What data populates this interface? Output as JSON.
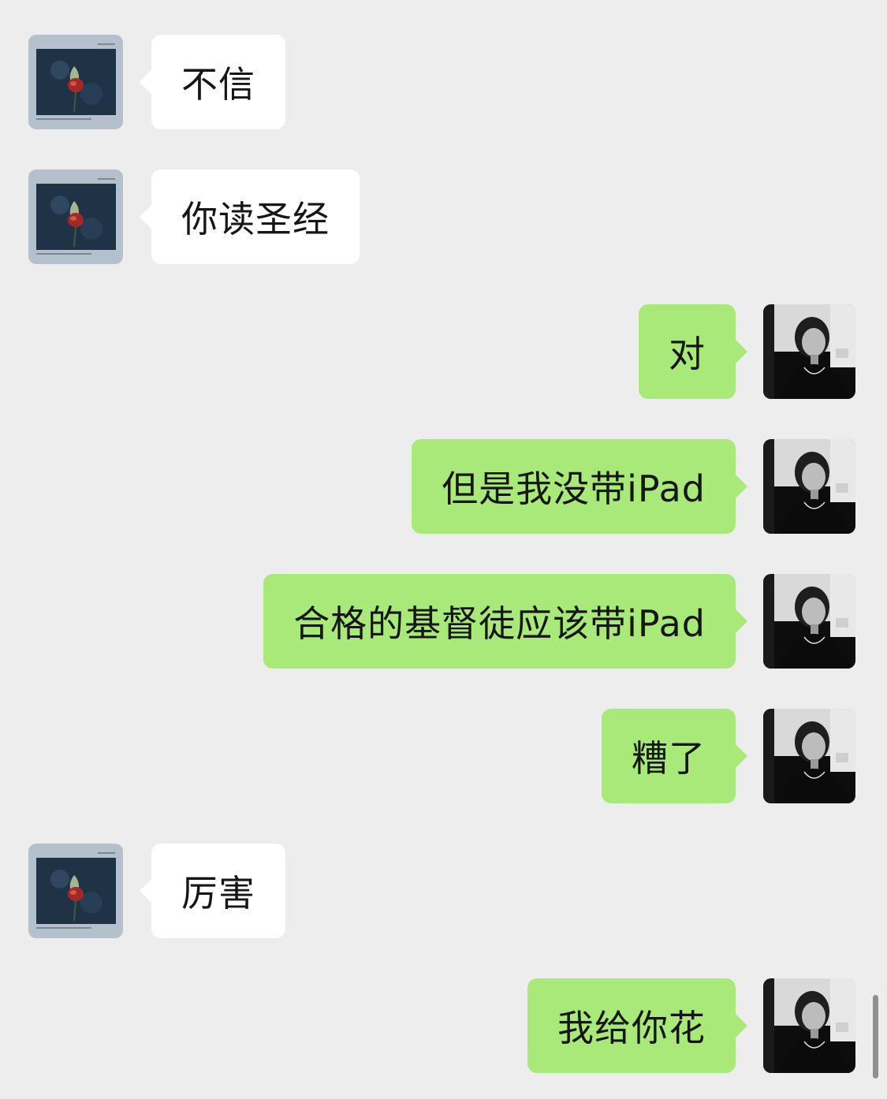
{
  "colors": {
    "background": "#ededed",
    "incoming_bubble": "#ffffff",
    "outgoing_bubble": "#a9e97a",
    "text": "#161616"
  },
  "messages": [
    {
      "side": "left",
      "text": "不信"
    },
    {
      "side": "left",
      "text": "你读圣经"
    },
    {
      "side": "right",
      "text": "对"
    },
    {
      "side": "right",
      "text": "但是我没带iPad"
    },
    {
      "side": "right",
      "text": "合格的基督徒应该带iPad"
    },
    {
      "side": "right",
      "text": "糟了"
    },
    {
      "side": "left",
      "text": "厉害"
    },
    {
      "side": "right",
      "text": "我给你花"
    }
  ],
  "avatars": {
    "contact": "rose-album-avatar-icon",
    "self": "portrait-photo-avatar-icon"
  }
}
